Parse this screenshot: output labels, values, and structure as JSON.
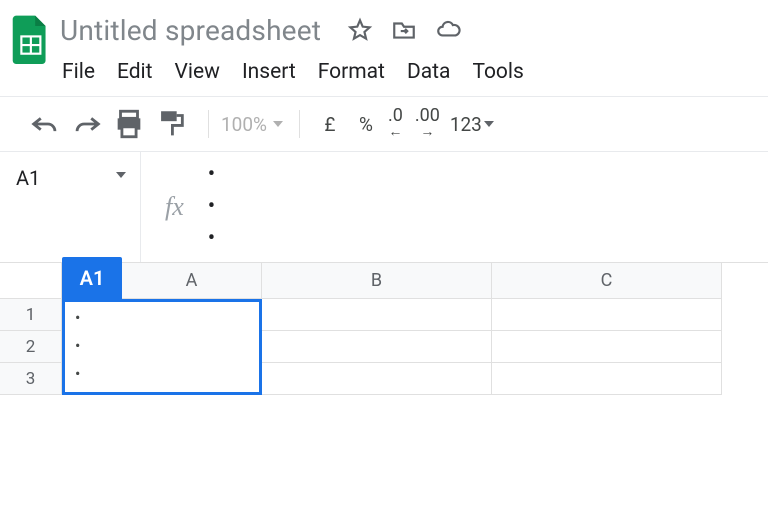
{
  "header": {
    "title": "Untitled spreadsheet"
  },
  "menu": {
    "file": "File",
    "edit": "Edit",
    "view": "View",
    "insert": "Insert",
    "format": "Format",
    "data": "Data",
    "tools": "Tools"
  },
  "toolbar": {
    "zoom": "100%",
    "currency": "£",
    "percent": "%",
    "dec_decrease": ".0",
    "dec_increase": ".00",
    "numformat": "123"
  },
  "namebox": {
    "value": "A1"
  },
  "formula": {
    "lines": [
      "",
      "",
      ""
    ]
  },
  "grid": {
    "a1badge": "A1",
    "cols": {
      "A": "A",
      "B": "B",
      "C": "C"
    },
    "rows": {
      "r1": "1",
      "r2": "2",
      "r3": "3"
    },
    "active_cell_lines": [
      "",
      "",
      ""
    ]
  }
}
